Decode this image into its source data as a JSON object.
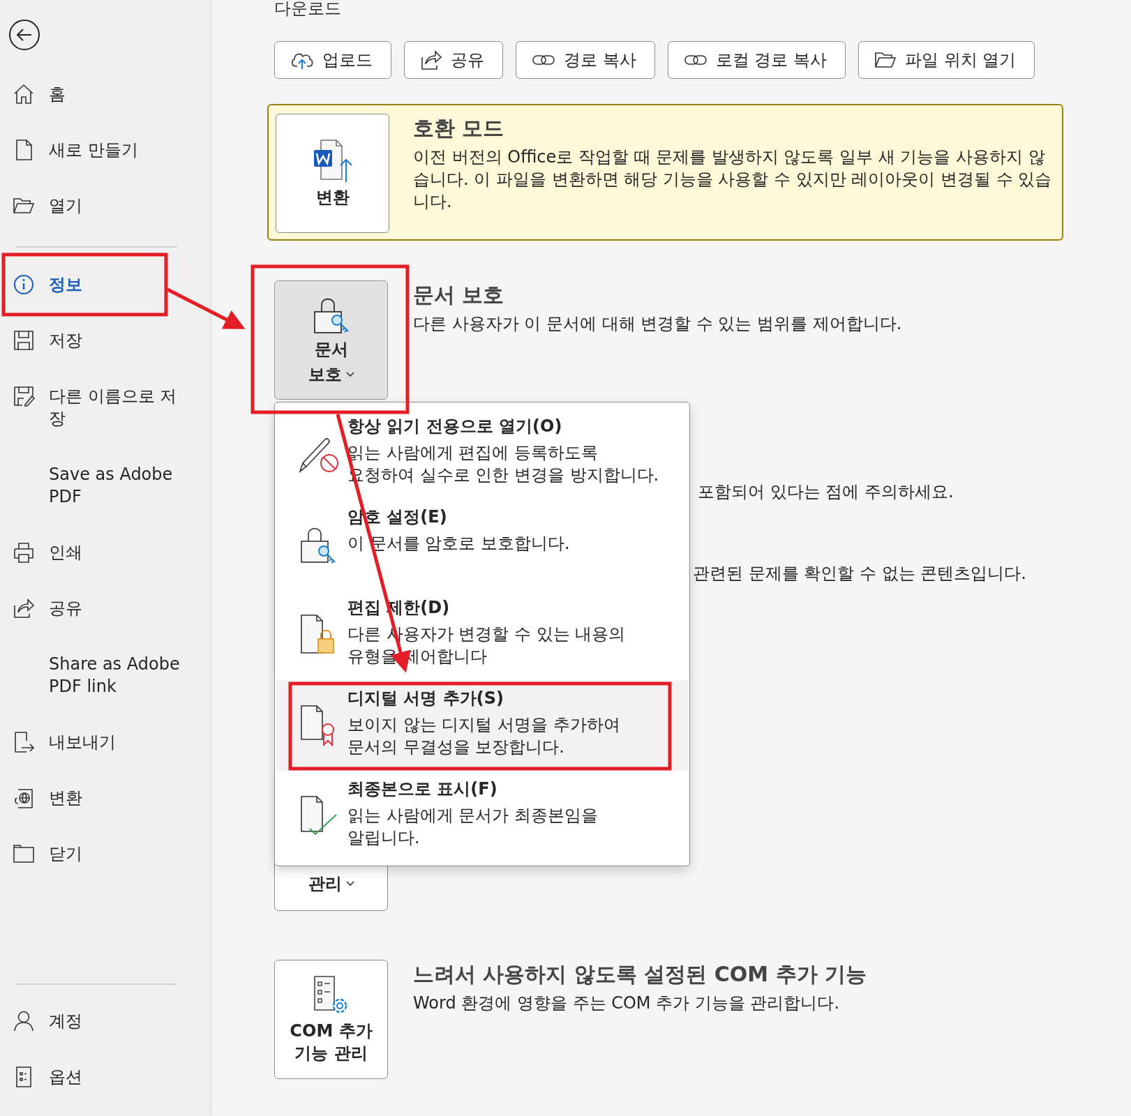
{
  "sidebar": {
    "items": [
      {
        "label": "홈",
        "selected": false
      },
      {
        "label": "새로 만들기",
        "selected": false
      },
      {
        "label": "열기",
        "selected": false
      },
      {
        "kind": "divider"
      },
      {
        "label": "정보",
        "selected": true
      },
      {
        "label": "저장",
        "selected": false
      },
      {
        "label": "다른 이름으로 저\n장",
        "selected": false
      },
      {
        "label": "Save as Adobe\nPDF",
        "selected": false
      },
      {
        "label": "인쇄",
        "selected": false
      },
      {
        "label": "공유",
        "selected": false
      },
      {
        "label": "Share as Adobe\nPDF link",
        "selected": false
      },
      {
        "label": "내보내기",
        "selected": false
      },
      {
        "label": "변환",
        "selected": false
      },
      {
        "label": "닫기",
        "selected": false
      }
    ],
    "bottom_items": [
      {
        "label": "계정",
        "selected": false
      },
      {
        "label": "옵션",
        "selected": false
      }
    ]
  },
  "main": {
    "top_text": "다운로드",
    "actions": [
      {
        "label": "업로드"
      },
      {
        "label": "공유"
      },
      {
        "label": "경로 복사"
      },
      {
        "label": "로컬 경로 복사"
      },
      {
        "label": "파일 위치 열기"
      }
    ],
    "compat": {
      "button": "변환",
      "title": "호환 모드",
      "description": "이전 버전의 Office로 작업할 때 문제를 발생하지 않도록 일부 새 기능을 사용하지 않\n습니다. 이 파일을 변환하면 해당 기능을 사용할 수 있지만 레이아웃이 변경될 수 있습\n니다."
    },
    "protect": {
      "button": "문서\n보호",
      "title": "문서 보호",
      "description": "다른 사용자가 이 문서에 대해 변경할 수 있는 범위를 제어합니다."
    },
    "partial_texts": [
      "포함되어 있다는 점에 주의하세요.",
      "관련된 문제를 확인할 수 없는 콘텐츠입니다."
    ],
    "manage": {
      "button": "관리"
    },
    "com": {
      "button": "COM 추가\n기능 관리",
      "title": "느려서 사용하지 않도록 설정된 COM 추가 기능",
      "description": "Word 환경에 영향을 주는 COM 추가 기능을 관리합니다."
    }
  },
  "protect_menu": {
    "items": [
      {
        "title": "항상 읽기 전용으로 열기(O)",
        "description": "읽는 사람에게 편집에 등록하도록\n요청하여 실수로 인한 변경을 방지합니다.",
        "selected": false
      },
      {
        "title": "암호 설정(E)",
        "description": "이 문서를 암호로 보호합니다.",
        "selected": false
      },
      {
        "title": "편집 제한(D)",
        "description": "다른 사용자가 변경할 수 있는 내용의\n유형을 제어합니다",
        "selected": false
      },
      {
        "title": "디지털 서명 추가(S)",
        "description": "보이지 않는 디지털 서명을 추가하여\n문서의 무결성을 보장합니다.",
        "selected": true
      },
      {
        "title": "최종본으로 표시(F)",
        "description": "읽는 사람에게 문서가 최종본임을\n알립니다.",
        "selected": false
      }
    ]
  }
}
